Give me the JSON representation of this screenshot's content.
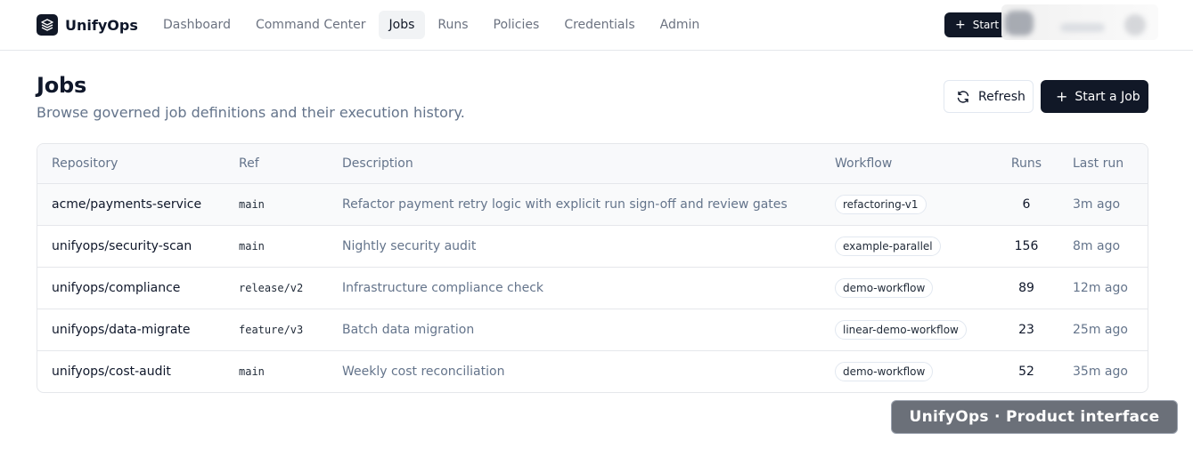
{
  "app": {
    "name": "UnifyOps",
    "logo_icon": "layers-icon"
  },
  "nav": {
    "items": [
      {
        "label": "Dashboard",
        "active": false
      },
      {
        "label": "Command Center",
        "active": false
      },
      {
        "label": "Jobs",
        "active": true
      },
      {
        "label": "Runs",
        "active": false
      },
      {
        "label": "Policies",
        "active": false
      },
      {
        "label": "Credentials",
        "active": false
      },
      {
        "label": "Admin",
        "active": false
      }
    ],
    "start_label": "Start"
  },
  "page": {
    "title": "Jobs",
    "subtitle": "Browse governed job definitions and their execution history.",
    "refresh_label": "Refresh",
    "start_job_label": "Start a Job"
  },
  "table": {
    "headers": {
      "repository": "Repository",
      "ref": "Ref",
      "description": "Description",
      "workflow": "Workflow",
      "runs": "Runs",
      "last_run": "Last run"
    },
    "rows": [
      {
        "repository": "acme/payments-service",
        "ref": "main",
        "description": "Refactor payment retry logic with explicit run sign-off and review gates",
        "workflow": "refactoring-v1",
        "runs": "6",
        "last_run": "3m ago"
      },
      {
        "repository": "unifyops/security-scan",
        "ref": "main",
        "description": "Nightly security audit",
        "workflow": "example-parallel",
        "runs": "156",
        "last_run": "8m ago"
      },
      {
        "repository": "unifyops/compliance",
        "ref": "release/v2",
        "description": "Infrastructure compliance check",
        "workflow": "demo-workflow",
        "runs": "89",
        "last_run": "12m ago"
      },
      {
        "repository": "unifyops/data-migrate",
        "ref": "feature/v3",
        "description": "Batch data migration",
        "workflow": "linear-demo-workflow",
        "runs": "23",
        "last_run": "25m ago"
      },
      {
        "repository": "unifyops/cost-audit",
        "ref": "main",
        "description": "Weekly cost reconciliation",
        "workflow": "demo-workflow",
        "runs": "52",
        "last_run": "35m ago"
      }
    ]
  },
  "watermark": "UnifyOps · Product interface",
  "colors": {
    "primary": "#111827",
    "muted_text": "#64748b",
    "border": "#e5e7eb"
  }
}
